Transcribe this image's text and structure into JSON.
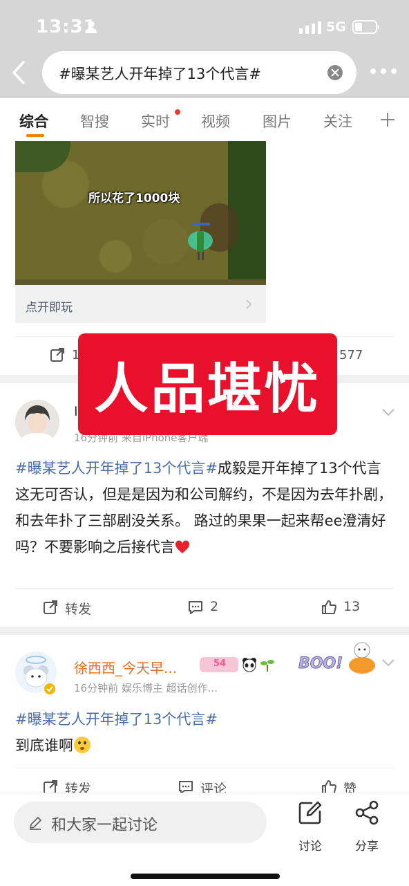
{
  "status_bar": {
    "time": "13:31",
    "network": "5G"
  },
  "search": {
    "query": "#曝某艺人开年掉了13个代言#"
  },
  "tabs": [
    {
      "label": "综合"
    },
    {
      "label": "智搜"
    },
    {
      "label": "实时"
    },
    {
      "label": "视频"
    },
    {
      "label": "图片"
    },
    {
      "label": "关注"
    }
  ],
  "game_card": {
    "caption": "所以花了1000块",
    "footer": "点开即玩",
    "repost_count": "1",
    "like_count": "577"
  },
  "overlay": {
    "text": "人品堪忧"
  },
  "post1": {
    "name": "I",
    "meta": "16分钟前  来自iPhone客户端",
    "hashtag": "#曝某艺人开年掉了13个代言#",
    "body": "成毅是开年掉了13个代言这无可否认，但是是因为和公司解约，不是因为去年扑剧，和去年扑了三部剧没关系。 路过的果果一起来帮ee澄清好吗？不要影响之后接代言",
    "actions": {
      "repost": "转发",
      "comment": "2",
      "like": "13"
    }
  },
  "post2": {
    "name": "徐西西_今天早...",
    "badge": "54",
    "meta": "16分钟前  娱乐博主  超话创作...",
    "hashtag": "#曝某艺人开年掉了13个代言#",
    "body": "到底谁啊",
    "actions": {
      "repost": "转发",
      "comment": "评论",
      "like": "赞"
    }
  },
  "bottom_bar": {
    "input_placeholder": "和大家一起讨论",
    "discuss": "讨论",
    "share": "分享"
  },
  "colors": {
    "accent": "#f08300",
    "hashtag": "#4b6ea8",
    "overlay": "#e8102a"
  }
}
